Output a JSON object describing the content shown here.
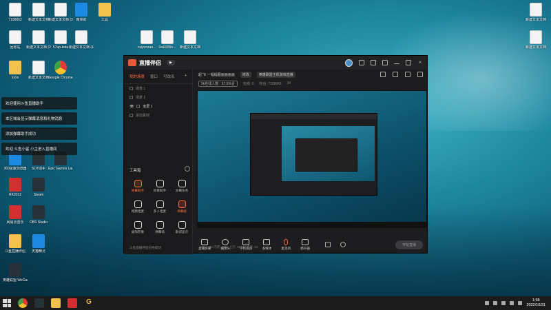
{
  "desktop_icons": [
    {
      "label": "7199062",
      "type": "doc",
      "icon": "doc-icon"
    },
    {
      "label": "新建文本文档",
      "type": "doc",
      "icon": "doc-icon"
    },
    {
      "label": "新建文本文档 (3)",
      "type": "doc",
      "icon": "doc-icon"
    },
    {
      "label": "雨果助",
      "type": "blue-b",
      "icon": "app-icon"
    },
    {
      "label": "工具",
      "type": "folder",
      "icon": "folder-icon"
    },
    {
      "label": "回收站",
      "type": "doc",
      "icon": "recycle-bin-icon"
    },
    {
      "label": "新建文本文档 (2)",
      "type": "doc",
      "icon": "doc-icon"
    },
    {
      "label": "57ap-kata",
      "type": "doc",
      "icon": "doc-icon"
    },
    {
      "label": "新建文本文档 (4)",
      "type": "doc",
      "icon": "doc-icon"
    },
    {
      "label": "caiyunzao...",
      "type": "doc",
      "icon": "doc-icon"
    },
    {
      "label": "0a4605fe...",
      "type": "doc",
      "icon": "doc-icon"
    },
    {
      "label": "新建文本文档",
      "type": "doc",
      "icon": "doc-icon"
    },
    {
      "label": "tools",
      "type": "folder",
      "icon": "folder-icon"
    },
    {
      "label": "新建文本文档",
      "type": "doc",
      "icon": "doc-icon"
    },
    {
      "label": "Google Chrome",
      "type": "chrome",
      "icon": "chrome-icon"
    },
    {
      "label": "360极速浏览器",
      "type": "blue-b",
      "icon": "browser-icon"
    },
    {
      "label": "SOT助手",
      "type": "dark",
      "icon": "app-icon"
    },
    {
      "label": "Epic Games Launcher",
      "type": "dark",
      "icon": "epic-games-icon"
    },
    {
      "label": "RK2012",
      "type": "red",
      "icon": "app-icon"
    },
    {
      "label": "Steam",
      "type": "dark",
      "icon": "steam-icon"
    },
    {
      "label": "网易云音乐",
      "type": "red",
      "icon": "music-icon"
    },
    {
      "label": "OBS Studio",
      "type": "dark",
      "icon": "obs-icon"
    },
    {
      "label": "斗鱼直播伴侣",
      "type": "folder",
      "icon": "douyu-icon"
    },
    {
      "label": "天猫精灵",
      "type": "blue-b",
      "icon": "app-icon"
    },
    {
      "label": "英雄联盟 WeGame版",
      "type": "dark",
      "icon": "game-icon"
    },
    {
      "label": "新建文本文档",
      "type": "doc",
      "icon": "doc-icon"
    },
    {
      "label": "新建文本文档",
      "type": "doc",
      "icon": "doc-icon"
    }
  ],
  "toasts": [
    "欢迎使用斗鱼直播助手",
    "本区域会显示弹幕消息和礼物消息",
    "添加弹幕助手成功",
    "欢迎 斗鱼小鲨 小主进入直播间"
  ],
  "app": {
    "logo": "直播伴侣",
    "logo_pill": "▶",
    "tabs": [
      "我的场景",
      "窗口",
      "可改名"
    ],
    "scenes": [
      "场景 1",
      "场景 2",
      "全屏 1",
      "添加素材"
    ],
    "room_title": "起飞! 一幅幅图画画画画",
    "category": "英雄联盟主机游戏直播",
    "edit_label": "修改",
    "online_label": "5k在线人数 · 57.5%合",
    "stats": [
      "在线: 0",
      "粉丝: 7199062"
    ],
    "likes": "34",
    "toolbox_title": "工具箱",
    "tools": [
      {
        "label": "弹幕助手",
        "hot": true
      },
      {
        "label": "房管助手",
        "hot": false
      },
      {
        "label": "主播任务",
        "hot": false
      },
      {
        "label": "视频连麦",
        "hot": false
      },
      {
        "label": "多人连麦",
        "hot": false
      },
      {
        "label": "弹幕姬",
        "hot": true
      },
      {
        "label": "虚拟形象",
        "hot": false
      },
      {
        "label": "弹幕墙",
        "hot": false
      },
      {
        "label": "歌词显示",
        "hot": false
      }
    ],
    "bottom_note": "斗鱼直播伴侣已经成功",
    "controls": [
      "直播屏幕",
      "摄像头",
      "手机投屏",
      "多媒体",
      "麦克风",
      "扬声器"
    ],
    "go_live": "开始直播",
    "status_line": "CPU: 4% 内存: 26% 上行: 0KB/s 帧率: 60"
  },
  "taskbar": {
    "time": "1:58",
    "date": "2022/10/31"
  }
}
